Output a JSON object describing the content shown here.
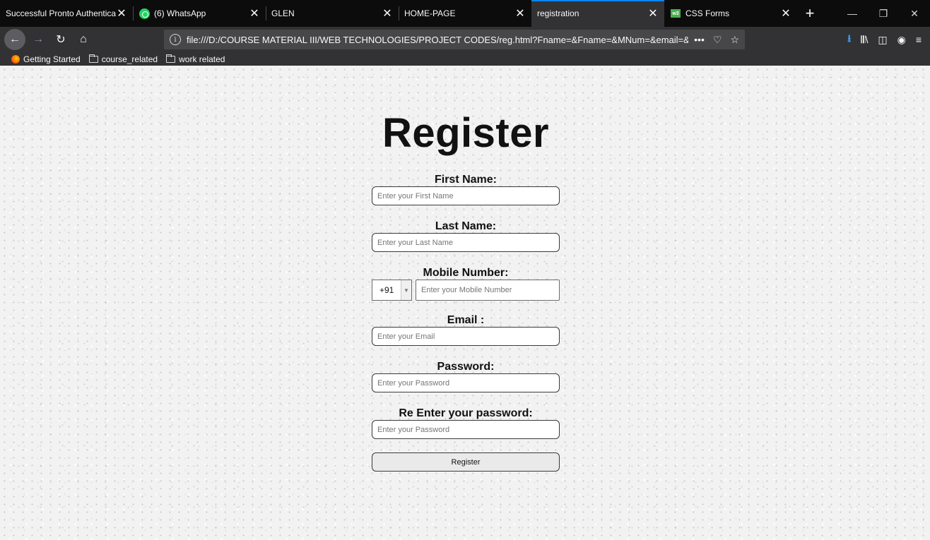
{
  "browser": {
    "tabs": [
      {
        "title": "Successful Pronto Authentication",
        "close": "✕",
        "favicon": "",
        "selected": false
      },
      {
        "title": "(6) WhatsApp",
        "close": "✕",
        "favicon": "whatsapp-icon",
        "selected": false
      },
      {
        "title": "GLEN",
        "close": "✕",
        "favicon": "",
        "selected": false
      },
      {
        "title": "HOME-PAGE",
        "close": "✕",
        "favicon": "",
        "selected": false
      },
      {
        "title": "registration",
        "close": "✕",
        "favicon": "",
        "selected": true
      },
      {
        "title": "CSS Forms",
        "close": "✕",
        "favicon": "w3schools-icon",
        "selected": false
      }
    ],
    "new_tab": "+",
    "url": "file:///D:/COURSE MATERIAL III/WEB TECHNOLOGIES/PROJECT CODES/reg.html?Fname=&Fname=&MNum=&email=&pass=&pa",
    "bookmarks": [
      {
        "label": "Getting Started",
        "icon": "firefox-icon"
      },
      {
        "label": "course_related",
        "icon": "folder-icon"
      },
      {
        "label": "work related",
        "icon": "folder-icon"
      }
    ],
    "accent_color": "#0a84ff"
  },
  "page": {
    "title": "Register",
    "first_name": {
      "label": "First Name:",
      "placeholder": "Enter your First Name"
    },
    "last_name": {
      "label": "Last Name:",
      "placeholder": "Enter your Last Name"
    },
    "mobile": {
      "label": "Mobile Number:",
      "country_code": "+91",
      "placeholder": "Enter your Mobile Number"
    },
    "email": {
      "label": "Email :",
      "placeholder": "Enter your Email"
    },
    "password": {
      "label": "Password:",
      "placeholder": "Enter your Password"
    },
    "reenter": {
      "label": "Re Enter your password:",
      "placeholder": "Enter your Password"
    },
    "submit_label": "Register"
  }
}
